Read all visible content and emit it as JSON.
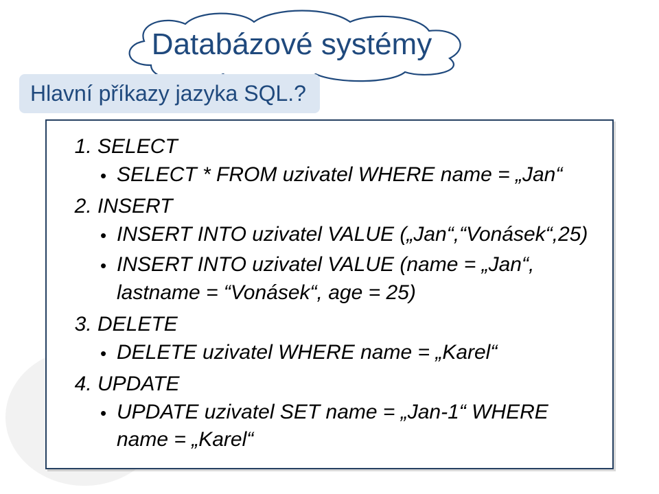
{
  "title": "Databázové systémy",
  "subtitle": "Hlavní příkazy jazyka SQL.?",
  "items": [
    {
      "heading": "SELECT",
      "subs": [
        "SELECT * FROM uzivatel WHERE name = „Jan“"
      ]
    },
    {
      "heading": "INSERT",
      "subs": [
        "INSERT INTO uzivatel VALUE („Jan“,“Vonásek“,25)",
        "INSERT INTO uzivatel VALUE (name = „Jan“, lastname = “Vonásek“, age = 25)"
      ]
    },
    {
      "heading": "DELETE",
      "subs": [
        "DELETE uzivatel WHERE name = „Karel“"
      ]
    },
    {
      "heading": "UPDATE",
      "subs": [
        "UPDATE uzivatel SET name = „Jan-1“ WHERE name = „Karel“"
      ]
    }
  ]
}
